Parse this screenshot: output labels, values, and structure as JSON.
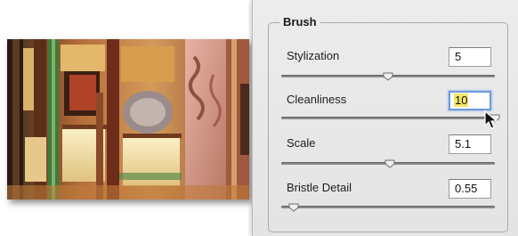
{
  "panel": {
    "group_title": "Brush",
    "settings": [
      {
        "label": "Stylization",
        "value": "5",
        "level": 0.5
      },
      {
        "label": "Cleanliness",
        "value": "10",
        "level": 1.0
      },
      {
        "label": "Scale",
        "value": "5.1",
        "level": 0.51
      },
      {
        "label": "Bristle Detail",
        "value": "0.55",
        "level": 0.06
      }
    ]
  },
  "preview": {
    "icon": "painted-image-preview"
  },
  "colors": {
    "panel_bg": "#ebebeb",
    "focus_ring": "#6c9ad6",
    "selection_highlight": "#f5e86a"
  }
}
